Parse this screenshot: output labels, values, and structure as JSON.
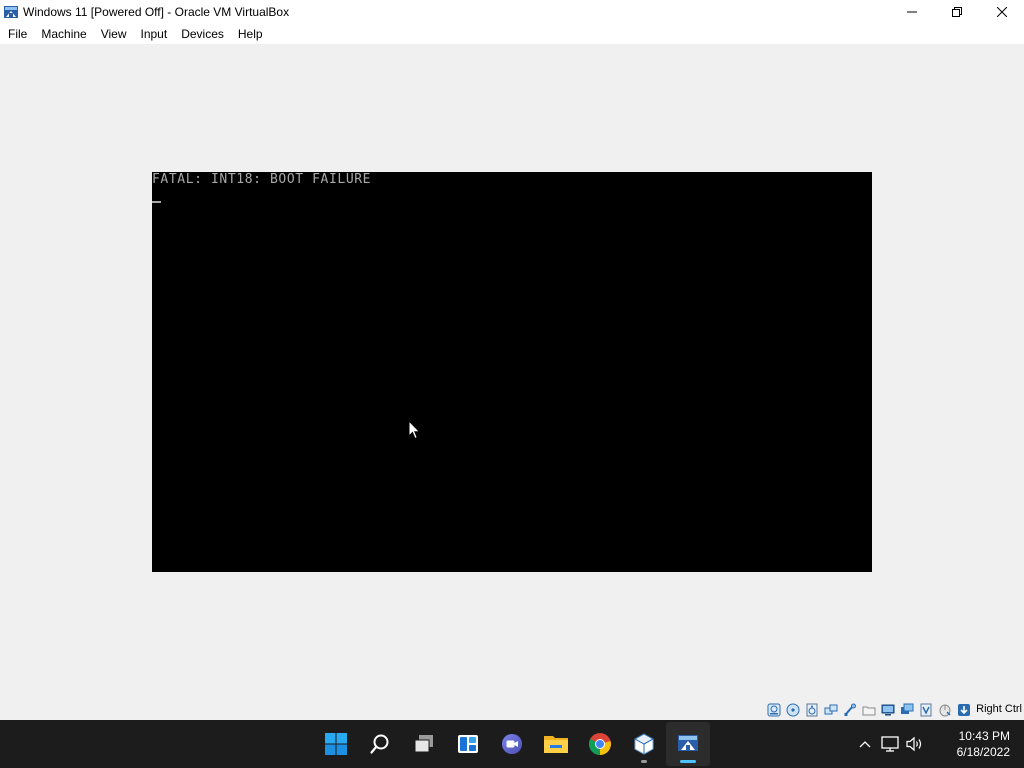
{
  "window": {
    "title": "Windows 11 [Powered Off] - Oracle VM VirtualBox",
    "controls": {
      "minimize": "—",
      "restore": "❐",
      "close": "✕"
    }
  },
  "menu": [
    "File",
    "Machine",
    "View",
    "Input",
    "Devices",
    "Help"
  ],
  "vm_console": {
    "message": "FATAL: INT18: BOOT FAILURE",
    "text_color": "#a8a8a8",
    "background": "#000000"
  },
  "statusbar": {
    "icons": [
      "hard-disk-icon",
      "optical-drive-icon",
      "audio-icon",
      "network-icon",
      "usb-icon",
      "shared-folders-icon",
      "display-icon",
      "recording-icon",
      "virtualization-icon",
      "mouse-integration-icon",
      "keyboard-capture-icon"
    ],
    "host_key": "Right Ctrl"
  },
  "taskbar": {
    "apps": [
      "start-icon",
      "search-icon",
      "task-view-icon",
      "widgets-icon",
      "chat-icon",
      "file-explorer-icon",
      "chrome-icon",
      "virtualbox-manager-icon",
      "virtualbox-vm-icon"
    ],
    "accent": "#4cc2ff",
    "background": "#1c1c1c"
  },
  "tray": {
    "icons": [
      "chevron-up-icon",
      "network-icon",
      "volume-icon"
    ],
    "time": "10:43 PM",
    "date": "6/18/2022"
  }
}
